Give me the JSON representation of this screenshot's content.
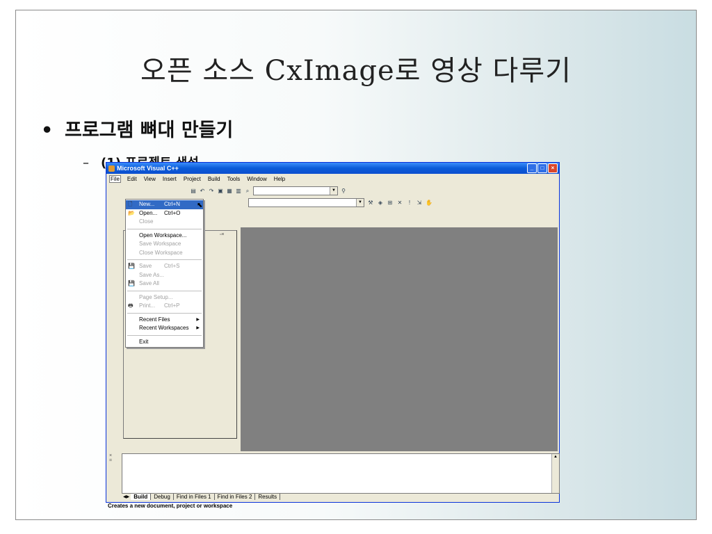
{
  "slide": {
    "title": "오픈 소스 CxImage로 영상 다루기",
    "bullet1": "프로그램 뼈대 만들기",
    "bullet2": "(1) 프로젝트 생성",
    "bullet_glyph": "•",
    "dash_glyph": "–"
  },
  "window": {
    "title": "Microsoft Visual C++",
    "menubar": [
      "File",
      "Edit",
      "View",
      "Insert",
      "Project",
      "Build",
      "Tools",
      "Window",
      "Help"
    ],
    "file_menu": [
      {
        "label": "New...",
        "shortcut": "Ctrl+N",
        "state": "selected",
        "icon": "new-file-icon"
      },
      {
        "label": "Open...",
        "shortcut": "Ctrl+O",
        "state": "enabled",
        "icon": "open-folder-icon"
      },
      {
        "label": "Close",
        "shortcut": "",
        "state": "disabled"
      },
      {
        "sep": true
      },
      {
        "label": "Open Workspace...",
        "shortcut": "",
        "state": "enabled"
      },
      {
        "label": "Save Workspace",
        "shortcut": "",
        "state": "disabled"
      },
      {
        "label": "Close Workspace",
        "shortcut": "",
        "state": "disabled"
      },
      {
        "sep": true
      },
      {
        "label": "Save",
        "shortcut": "Ctrl+S",
        "state": "disabled",
        "icon": "save-icon"
      },
      {
        "label": "Save As...",
        "shortcut": "",
        "state": "disabled"
      },
      {
        "label": "Save All",
        "shortcut": "",
        "state": "disabled",
        "icon": "save-all-icon"
      },
      {
        "sep": true
      },
      {
        "label": "Page Setup...",
        "shortcut": "",
        "state": "disabled"
      },
      {
        "label": "Print...",
        "shortcut": "Ctrl+P",
        "state": "disabled",
        "icon": "print-icon"
      },
      {
        "sep": true
      },
      {
        "label": "Recent Files",
        "shortcut": "",
        "state": "enabled",
        "submenu": true
      },
      {
        "label": "Recent Workspaces",
        "shortcut": "",
        "state": "enabled",
        "submenu": true
      },
      {
        "sep": true
      },
      {
        "label": "Exit",
        "shortcut": "",
        "state": "enabled"
      }
    ],
    "output_tabs": [
      "Build",
      "Debug",
      "Find in Files 1",
      "Find in Files 2",
      "Results"
    ],
    "active_tab": "Build",
    "status_text": "Creates a new document, project or workspace"
  },
  "colors": {
    "titlebar": "#0a5bd8",
    "selection": "#316ac5",
    "mdi_background": "#808080"
  }
}
